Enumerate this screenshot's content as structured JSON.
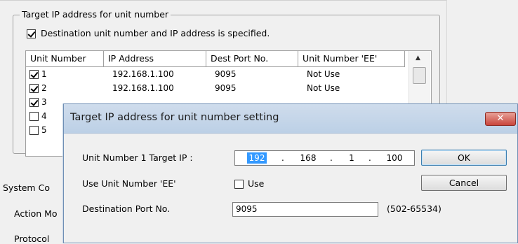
{
  "group": {
    "caption": "Target IP address for unit number",
    "specified_checkbox_label": "Destination unit number and IP address is specified."
  },
  "grid": {
    "columns": [
      "Unit Number",
      "IP Address",
      "Dest Port No.",
      "Unit Number 'EE'"
    ],
    "rows": [
      {
        "unit": "1",
        "ip": "192.168.1.100",
        "port": "9095",
        "ee": "Not Use",
        "checked": true
      },
      {
        "unit": "2",
        "ip": "192.168.1.100",
        "port": "9095",
        "ee": "Not Use",
        "checked": true
      },
      {
        "unit": "3",
        "checked": true
      },
      {
        "unit": "4",
        "checked": false
      },
      {
        "unit": "5",
        "checked": false
      }
    ]
  },
  "side_labels": {
    "system": "System Co",
    "action": "Action Mo",
    "protocol": "Protocol"
  },
  "dialog": {
    "title": "Target IP address for unit number setting",
    "target_ip_label": "Unit Number 1  Target IP :",
    "ip_octets": [
      "192",
      "168",
      "1",
      "100"
    ],
    "use_ee_label": "Use Unit Number 'EE'",
    "use_checkbox_label": "Use",
    "dest_port_label": "Destination Port No.",
    "dest_port_value": "9095",
    "port_range": "(502-65534)",
    "ok_label": "OK",
    "cancel_label": "Cancel",
    "close_glyph": "✕"
  }
}
